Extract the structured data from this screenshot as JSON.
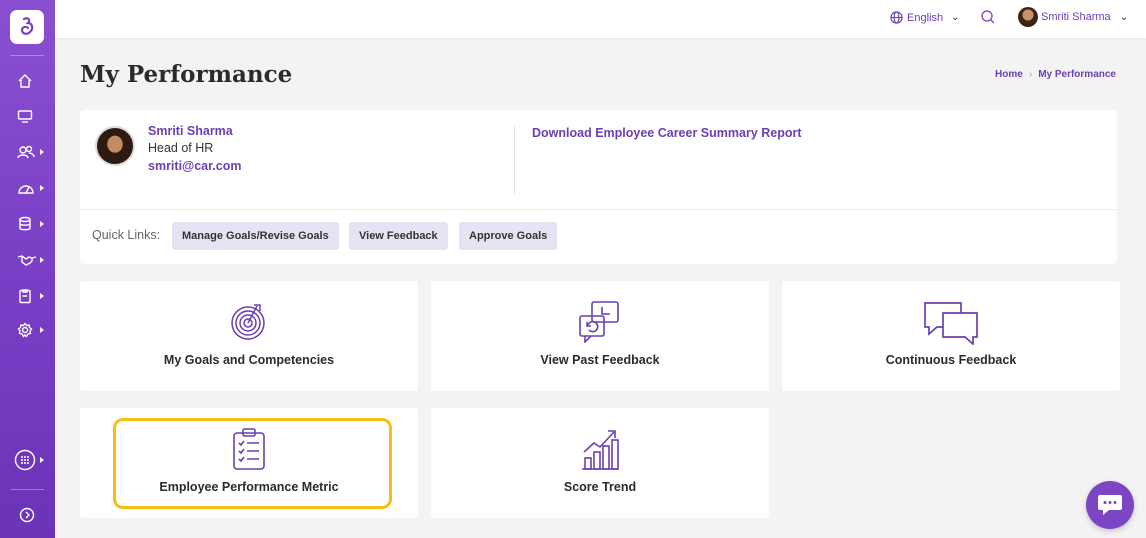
{
  "topbar": {
    "language": "English",
    "user_name": "Smriti Sharma"
  },
  "page": {
    "title": "My Performance",
    "breadcrumb": [
      "Home",
      "My Performance"
    ]
  },
  "profile": {
    "name": "Smriti Sharma",
    "role": "Head of HR",
    "email": "smriti@car.com",
    "download_link": "Download Employee Career Summary Report"
  },
  "quick_links": {
    "label": "Quick Links:",
    "items": [
      "Manage Goals/Revise Goals",
      "View Feedback",
      "Approve Goals"
    ]
  },
  "tiles": [
    {
      "label": "My Goals and Competencies",
      "icon": "target-icon"
    },
    {
      "label": "View Past Feedback",
      "icon": "feedback-history-icon"
    },
    {
      "label": "Continuous Feedback",
      "icon": "chat-bubbles-icon"
    },
    {
      "label": "Employee Performance Metric",
      "icon": "clipboard-checklist-icon",
      "highlighted": true
    },
    {
      "label": "Score Trend",
      "icon": "growth-chart-icon"
    }
  ],
  "sidebar_icons": [
    "home-icon",
    "monitor-icon",
    "users-icon",
    "dashboard-icon",
    "database-icon",
    "handshake-icon",
    "clipboard-icon",
    "settings-icon",
    "apps-grid-icon",
    "expand-icon"
  ],
  "colors": {
    "brand": "#7b3fc6",
    "accent_text": "#6a3fb5",
    "highlight": "#f6bd14",
    "quick_link_bg": "#e5e4f5"
  }
}
